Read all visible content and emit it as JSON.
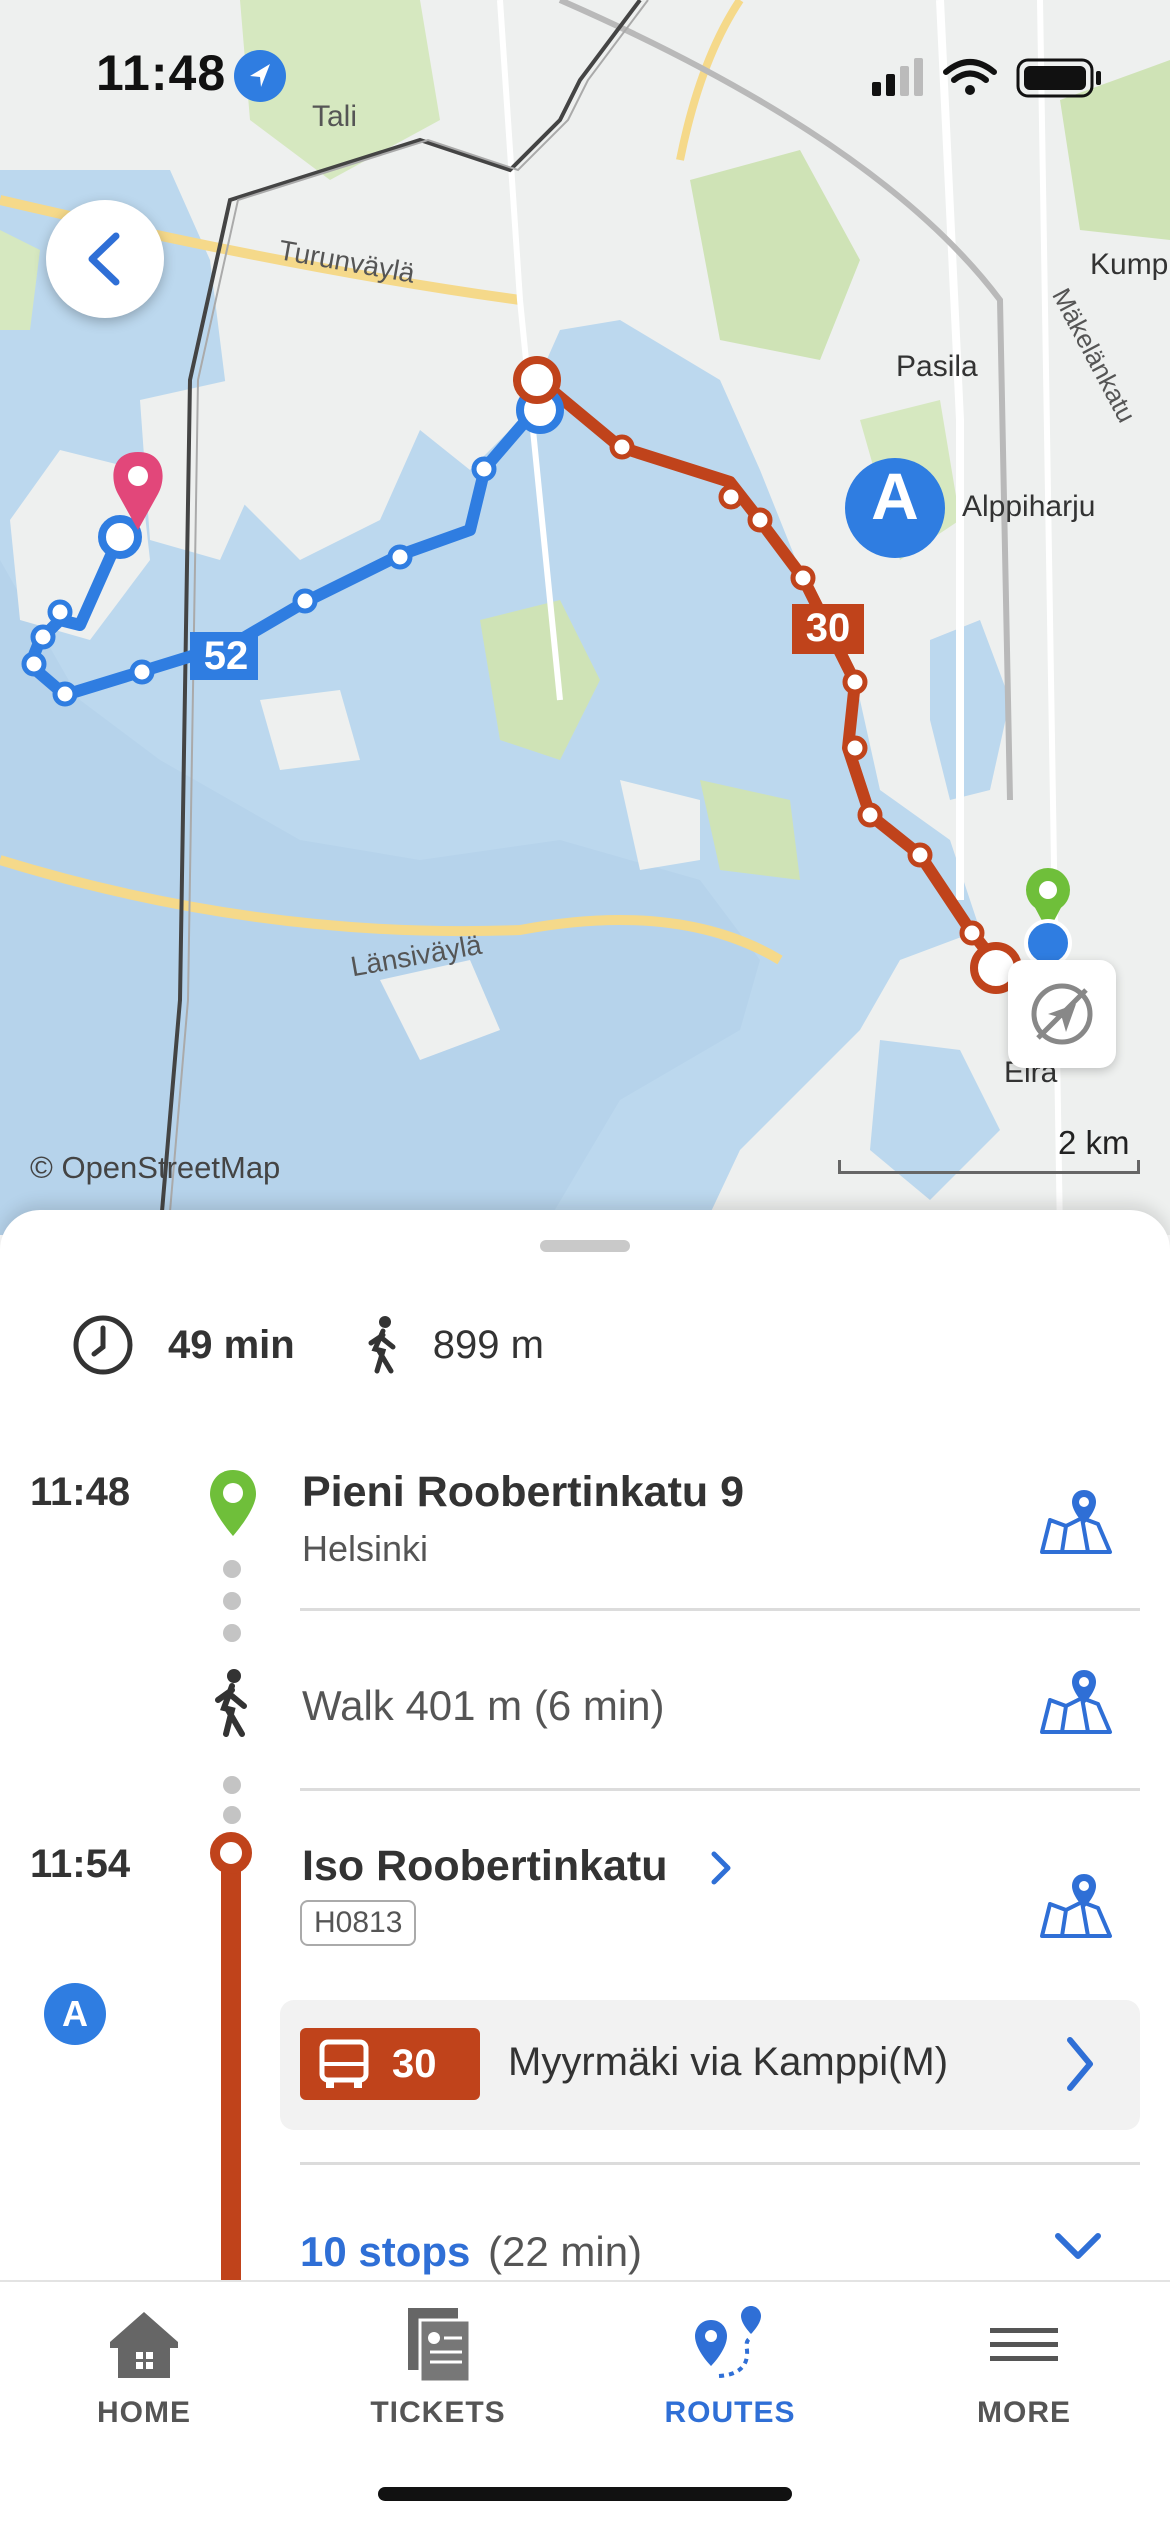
{
  "status_bar": {
    "time": "11:48"
  },
  "map": {
    "labels": {
      "tali": "Tali",
      "turunvayla": "Turunväylä",
      "pasila": "Pasila",
      "alppiharju": "Alppiharju",
      "kump": "Kump",
      "makelankatu": "Mäkelänkatu",
      "lansivayla": "Länsiväylä",
      "eira": "Eira"
    },
    "route_badges": {
      "blue": "52",
      "red": "30",
      "zone": "A"
    },
    "attribution": "© OpenStreetMap",
    "scale": "2 km",
    "colors": {
      "water": "#bcd8ee",
      "land": "#eef0ef",
      "park": "#cfe3b6",
      "blue_route": "#2f7de1",
      "red_route": "#c0431b",
      "pin": "#e2477a",
      "origin": "#6fbf3a"
    }
  },
  "summary": {
    "duration": "49 min",
    "walk_distance": "899 m"
  },
  "itinerary": {
    "origin": {
      "time": "11:48",
      "title": "Pieni Roobertinkatu 9",
      "subtitle": "Helsinki"
    },
    "walk": {
      "text": "Walk 401 m (6 min)"
    },
    "stop": {
      "time": "11:54",
      "title": "Iso Roobertinkatu",
      "code": "H0813",
      "zone": "A"
    },
    "leg": {
      "line": "30",
      "destination": "Myyrmäki via Kamppi(M)"
    },
    "stops": {
      "count_label": "10 stops",
      "duration": "(22 min)"
    }
  },
  "tabs": [
    {
      "label": "HOME",
      "icon": "home-icon"
    },
    {
      "label": "TICKETS",
      "icon": "tickets-icon"
    },
    {
      "label": "ROUTES",
      "icon": "routes-icon",
      "active": true
    },
    {
      "label": "MORE",
      "icon": "menu-icon"
    }
  ]
}
